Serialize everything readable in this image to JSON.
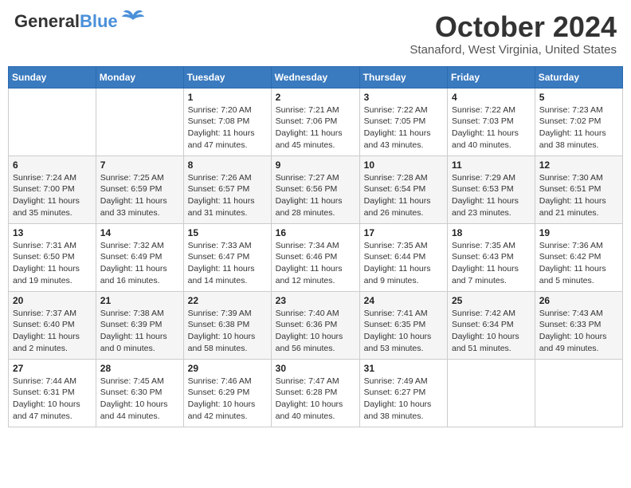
{
  "header": {
    "logo_general": "General",
    "logo_blue": "Blue",
    "month": "October 2024",
    "location": "Stanaford, West Virginia, United States"
  },
  "days_of_week": [
    "Sunday",
    "Monday",
    "Tuesday",
    "Wednesday",
    "Thursday",
    "Friday",
    "Saturday"
  ],
  "weeks": [
    [
      {
        "day": "",
        "sunrise": "",
        "sunset": "",
        "daylight": ""
      },
      {
        "day": "",
        "sunrise": "",
        "sunset": "",
        "daylight": ""
      },
      {
        "day": "1",
        "sunrise": "Sunrise: 7:20 AM",
        "sunset": "Sunset: 7:08 PM",
        "daylight": "Daylight: 11 hours and 47 minutes."
      },
      {
        "day": "2",
        "sunrise": "Sunrise: 7:21 AM",
        "sunset": "Sunset: 7:06 PM",
        "daylight": "Daylight: 11 hours and 45 minutes."
      },
      {
        "day": "3",
        "sunrise": "Sunrise: 7:22 AM",
        "sunset": "Sunset: 7:05 PM",
        "daylight": "Daylight: 11 hours and 43 minutes."
      },
      {
        "day": "4",
        "sunrise": "Sunrise: 7:22 AM",
        "sunset": "Sunset: 7:03 PM",
        "daylight": "Daylight: 11 hours and 40 minutes."
      },
      {
        "day": "5",
        "sunrise": "Sunrise: 7:23 AM",
        "sunset": "Sunset: 7:02 PM",
        "daylight": "Daylight: 11 hours and 38 minutes."
      }
    ],
    [
      {
        "day": "6",
        "sunrise": "Sunrise: 7:24 AM",
        "sunset": "Sunset: 7:00 PM",
        "daylight": "Daylight: 11 hours and 35 minutes."
      },
      {
        "day": "7",
        "sunrise": "Sunrise: 7:25 AM",
        "sunset": "Sunset: 6:59 PM",
        "daylight": "Daylight: 11 hours and 33 minutes."
      },
      {
        "day": "8",
        "sunrise": "Sunrise: 7:26 AM",
        "sunset": "Sunset: 6:57 PM",
        "daylight": "Daylight: 11 hours and 31 minutes."
      },
      {
        "day": "9",
        "sunrise": "Sunrise: 7:27 AM",
        "sunset": "Sunset: 6:56 PM",
        "daylight": "Daylight: 11 hours and 28 minutes."
      },
      {
        "day": "10",
        "sunrise": "Sunrise: 7:28 AM",
        "sunset": "Sunset: 6:54 PM",
        "daylight": "Daylight: 11 hours and 26 minutes."
      },
      {
        "day": "11",
        "sunrise": "Sunrise: 7:29 AM",
        "sunset": "Sunset: 6:53 PM",
        "daylight": "Daylight: 11 hours and 23 minutes."
      },
      {
        "day": "12",
        "sunrise": "Sunrise: 7:30 AM",
        "sunset": "Sunset: 6:51 PM",
        "daylight": "Daylight: 11 hours and 21 minutes."
      }
    ],
    [
      {
        "day": "13",
        "sunrise": "Sunrise: 7:31 AM",
        "sunset": "Sunset: 6:50 PM",
        "daylight": "Daylight: 11 hours and 19 minutes."
      },
      {
        "day": "14",
        "sunrise": "Sunrise: 7:32 AM",
        "sunset": "Sunset: 6:49 PM",
        "daylight": "Daylight: 11 hours and 16 minutes."
      },
      {
        "day": "15",
        "sunrise": "Sunrise: 7:33 AM",
        "sunset": "Sunset: 6:47 PM",
        "daylight": "Daylight: 11 hours and 14 minutes."
      },
      {
        "day": "16",
        "sunrise": "Sunrise: 7:34 AM",
        "sunset": "Sunset: 6:46 PM",
        "daylight": "Daylight: 11 hours and 12 minutes."
      },
      {
        "day": "17",
        "sunrise": "Sunrise: 7:35 AM",
        "sunset": "Sunset: 6:44 PM",
        "daylight": "Daylight: 11 hours and 9 minutes."
      },
      {
        "day": "18",
        "sunrise": "Sunrise: 7:35 AM",
        "sunset": "Sunset: 6:43 PM",
        "daylight": "Daylight: 11 hours and 7 minutes."
      },
      {
        "day": "19",
        "sunrise": "Sunrise: 7:36 AM",
        "sunset": "Sunset: 6:42 PM",
        "daylight": "Daylight: 11 hours and 5 minutes."
      }
    ],
    [
      {
        "day": "20",
        "sunrise": "Sunrise: 7:37 AM",
        "sunset": "Sunset: 6:40 PM",
        "daylight": "Daylight: 11 hours and 2 minutes."
      },
      {
        "day": "21",
        "sunrise": "Sunrise: 7:38 AM",
        "sunset": "Sunset: 6:39 PM",
        "daylight": "Daylight: 11 hours and 0 minutes."
      },
      {
        "day": "22",
        "sunrise": "Sunrise: 7:39 AM",
        "sunset": "Sunset: 6:38 PM",
        "daylight": "Daylight: 10 hours and 58 minutes."
      },
      {
        "day": "23",
        "sunrise": "Sunrise: 7:40 AM",
        "sunset": "Sunset: 6:36 PM",
        "daylight": "Daylight: 10 hours and 56 minutes."
      },
      {
        "day": "24",
        "sunrise": "Sunrise: 7:41 AM",
        "sunset": "Sunset: 6:35 PM",
        "daylight": "Daylight: 10 hours and 53 minutes."
      },
      {
        "day": "25",
        "sunrise": "Sunrise: 7:42 AM",
        "sunset": "Sunset: 6:34 PM",
        "daylight": "Daylight: 10 hours and 51 minutes."
      },
      {
        "day": "26",
        "sunrise": "Sunrise: 7:43 AM",
        "sunset": "Sunset: 6:33 PM",
        "daylight": "Daylight: 10 hours and 49 minutes."
      }
    ],
    [
      {
        "day": "27",
        "sunrise": "Sunrise: 7:44 AM",
        "sunset": "Sunset: 6:31 PM",
        "daylight": "Daylight: 10 hours and 47 minutes."
      },
      {
        "day": "28",
        "sunrise": "Sunrise: 7:45 AM",
        "sunset": "Sunset: 6:30 PM",
        "daylight": "Daylight: 10 hours and 44 minutes."
      },
      {
        "day": "29",
        "sunrise": "Sunrise: 7:46 AM",
        "sunset": "Sunset: 6:29 PM",
        "daylight": "Daylight: 10 hours and 42 minutes."
      },
      {
        "day": "30",
        "sunrise": "Sunrise: 7:47 AM",
        "sunset": "Sunset: 6:28 PM",
        "daylight": "Daylight: 10 hours and 40 minutes."
      },
      {
        "day": "31",
        "sunrise": "Sunrise: 7:49 AM",
        "sunset": "Sunset: 6:27 PM",
        "daylight": "Daylight: 10 hours and 38 minutes."
      },
      {
        "day": "",
        "sunrise": "",
        "sunset": "",
        "daylight": ""
      },
      {
        "day": "",
        "sunrise": "",
        "sunset": "",
        "daylight": ""
      }
    ]
  ]
}
